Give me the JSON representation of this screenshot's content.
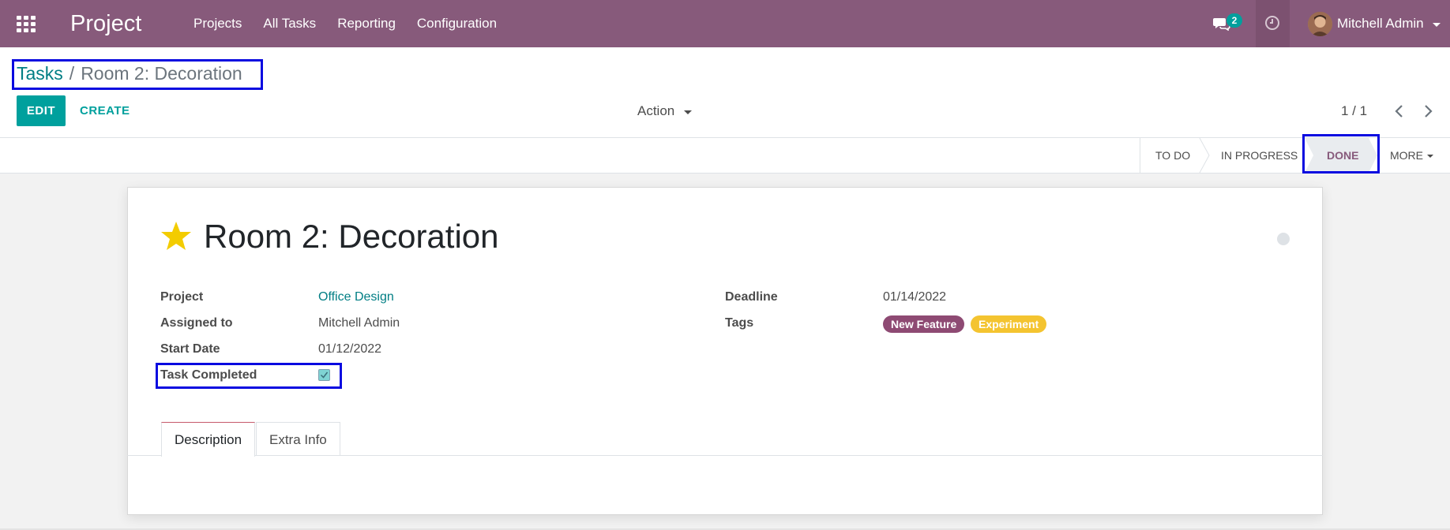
{
  "navbar": {
    "app_title": "Project",
    "menu": [
      "Projects",
      "All Tasks",
      "Reporting",
      "Configuration"
    ],
    "chat_count": "2",
    "user_name": "Mitchell Admin",
    "color": "#875a7b"
  },
  "breadcrumb": {
    "parent": "Tasks",
    "separator": "/",
    "current": "Room 2: Decoration"
  },
  "buttons": {
    "edit": "EDIT",
    "create": "CREATE",
    "action": "Action"
  },
  "pager": {
    "value": "1 / 1"
  },
  "stages": {
    "todo": "TO DO",
    "in_progress": "IN PROGRESS",
    "done": "DONE",
    "more": "MORE",
    "active": "DONE"
  },
  "record": {
    "title": "Room 2: Decoration",
    "starred": true,
    "fields": {
      "project_label": "Project",
      "project_value": "Office Design",
      "assigned_label": "Assigned to",
      "assigned_value": "Mitchell Admin",
      "start_label": "Start Date",
      "start_value": "01/12/2022",
      "completed_label": "Task Completed",
      "completed_value": true,
      "deadline_label": "Deadline",
      "deadline_value": "01/14/2022",
      "tags_label": "Tags"
    },
    "tags": [
      {
        "label": "New Feature",
        "color": "#8e4a73"
      },
      {
        "label": "Experiment",
        "color": "#f4c430"
      }
    ]
  },
  "tabs": [
    {
      "label": "Description",
      "active": true
    },
    {
      "label": "Extra Info",
      "active": false
    }
  ],
  "colors": {
    "accent": "#00a09d",
    "link": "#017e84",
    "highlight_box": "#0a0ae0"
  }
}
